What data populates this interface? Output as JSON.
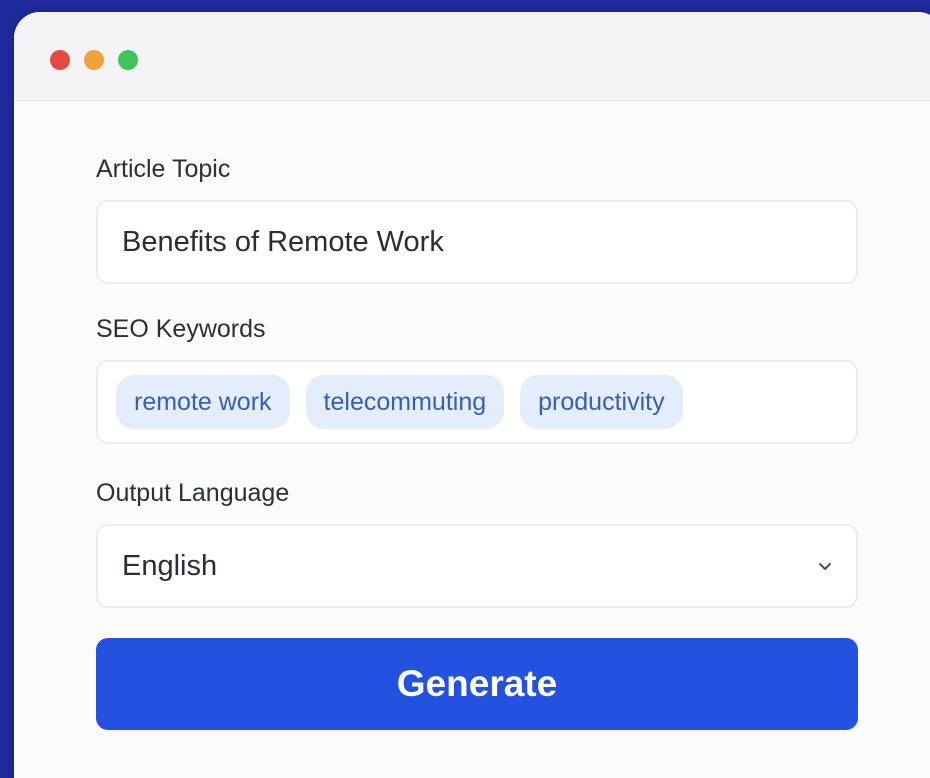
{
  "window": {
    "controls": [
      "close",
      "minimize",
      "zoom"
    ]
  },
  "form": {
    "topic": {
      "label": "Article Topic",
      "value": "Benefits of Remote Work"
    },
    "keywords": {
      "label": "SEO Keywords",
      "chips": [
        "remote work",
        "telecommuting",
        "productivity"
      ]
    },
    "language": {
      "label": "Output Language",
      "selected": "English"
    },
    "generate_label": "Generate"
  },
  "colors": {
    "background": "#1f2a9e",
    "accent": "#2451e0",
    "chip_bg": "#e3edfb",
    "chip_text": "#3a5db0"
  },
  "icons": {
    "select_chevron": "chevron-down-icon"
  }
}
